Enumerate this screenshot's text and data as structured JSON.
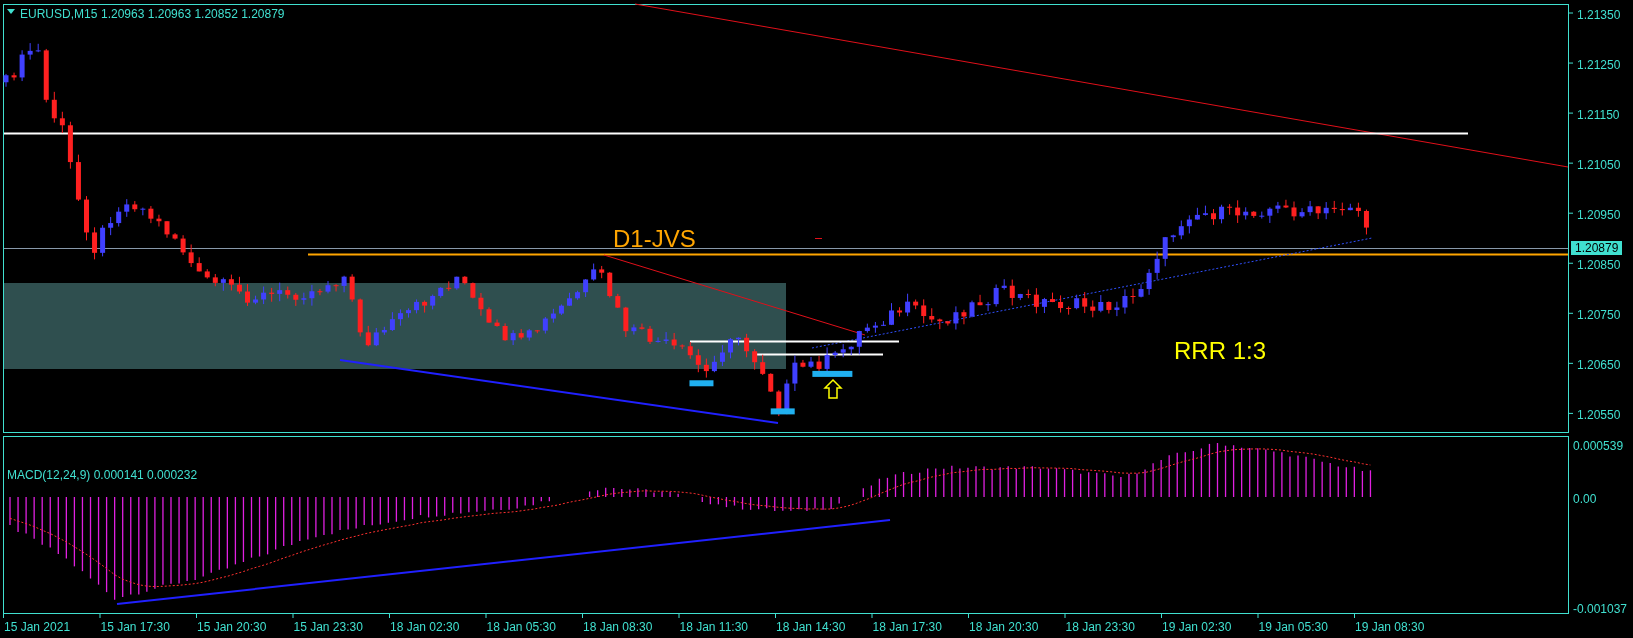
{
  "chart_header": {
    "symbol": "EURUSD,M15",
    "ohlc": "1.20963 1.20963 1.20852 1.20879"
  },
  "annotations": [
    {
      "kind": "level",
      "text": "D1-JVS"
    },
    {
      "kind": "ratio",
      "text": "RRR 1:3"
    }
  ],
  "price_axis": [
    "1.21350",
    "1.21250",
    "1.21150",
    "1.21050",
    "1.20950",
    "1.20850",
    "1.20750",
    "1.20650",
    "1.20550"
  ],
  "current_price": "1.20879",
  "macd_panel": {
    "label": "MACD(12,24,9) 0.000141 0.000232",
    "axis": [
      "0.000539",
      "0.00",
      "-0.001037"
    ]
  },
  "time_axis": [
    "15 Jan 2021",
    "15 Jan 17:30",
    "15 Jan 20:30",
    "15 Jan 23:30",
    "18 Jan 02:30",
    "18 Jan 05:30",
    "18 Jan 08:30",
    "18 Jan 11:30",
    "18 Jan 14:30",
    "18 Jan 17:30",
    "18 Jan 20:30",
    "18 Jan 23:30",
    "19 Jan 02:30",
    "19 Jan 05:30",
    "19 Jan 08:30"
  ]
}
